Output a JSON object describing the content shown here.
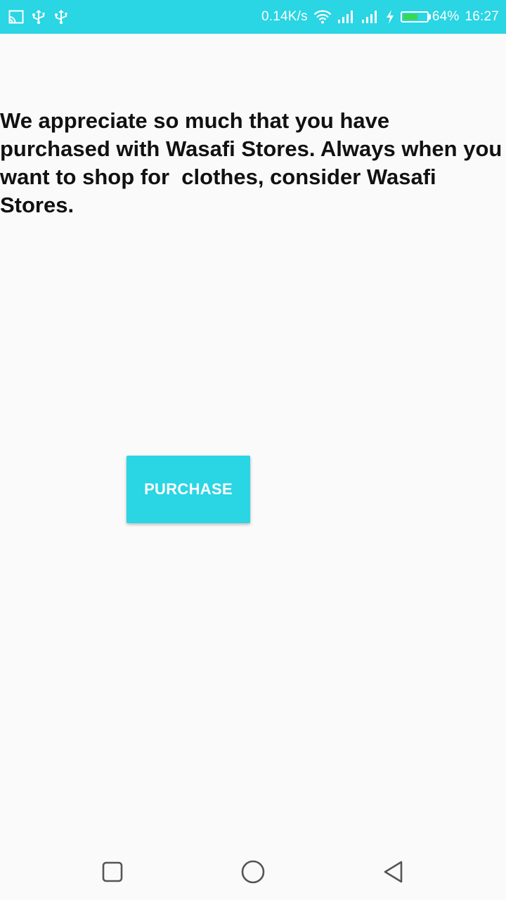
{
  "status_bar": {
    "network_speed": "0.14K/s",
    "battery_percent": "64%",
    "battery_level": 0.64,
    "time": "16:27",
    "background_color": "#2ad5e4",
    "battery_fill_color": "#38d94b",
    "left_icons": [
      "screen-cast-icon",
      "usb-icon",
      "usb-icon"
    ],
    "right_icons": [
      "wifi-icon",
      "signal-icon",
      "signal-icon",
      "charging-icon",
      "battery-icon"
    ]
  },
  "content": {
    "message": "We appreciate so much that you have purchased with Wasafi Stores. Always when you want to shop for  clothes, consider Wasafi Stores.",
    "purchase_button_label": "PURCHASE",
    "accent_color": "#2ad5e4"
  },
  "nav_bar": {
    "icons": [
      "recents-icon",
      "home-icon",
      "back-icon"
    ]
  }
}
